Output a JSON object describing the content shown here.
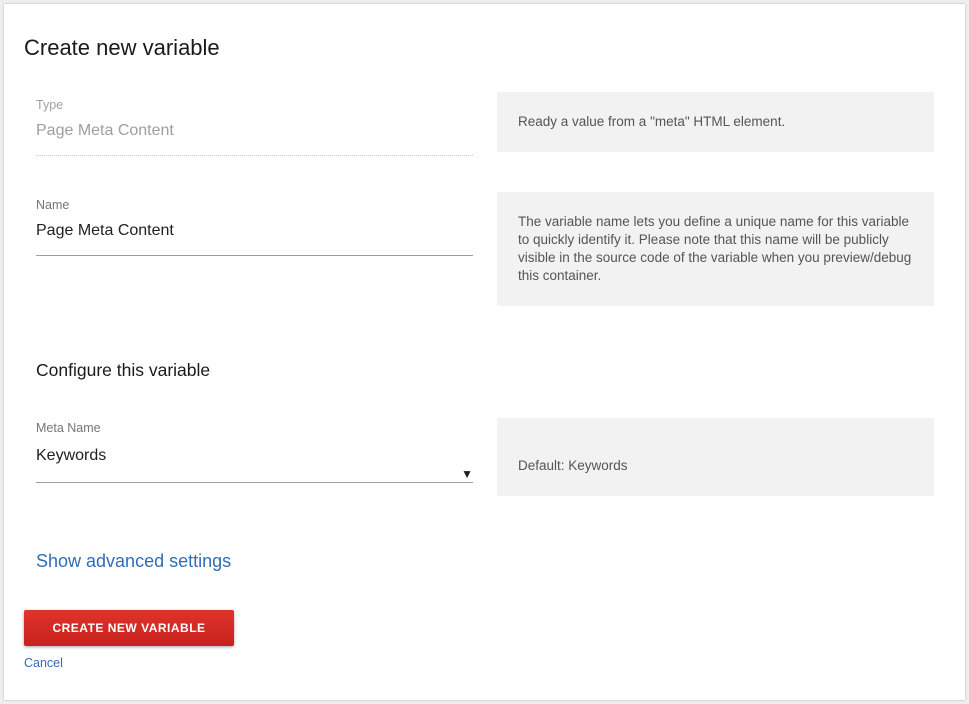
{
  "dialog": {
    "title": "Create new variable"
  },
  "type_field": {
    "label": "Type",
    "value": "Page Meta Content",
    "help": "Ready a value from a \"meta\" HTML element."
  },
  "name_field": {
    "label": "Name",
    "value": "Page Meta Content",
    "help": "The variable name lets you define a unique name for this variable to quickly identify it. Please note that this name will be publicly visible in the source code of the variable when you preview/debug this container."
  },
  "configure": {
    "title": "Configure this variable",
    "meta_name": {
      "label": "Meta Name",
      "selected": "Keywords",
      "arrow": "▼",
      "help": "Default: Keywords"
    }
  },
  "advanced_link": "Show advanced settings",
  "actions": {
    "create_label": "CREATE NEW VARIABLE",
    "cancel_label": "Cancel"
  },
  "colors": {
    "primary_button": "#d32b25",
    "link": "#2f6db7",
    "help_background": "#f2f2f2"
  }
}
